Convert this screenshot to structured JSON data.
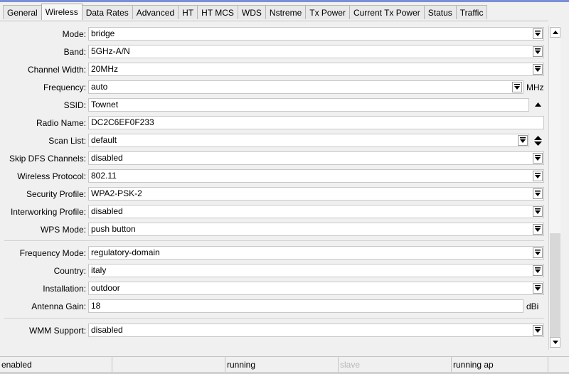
{
  "tabs": [
    "General",
    "Wireless",
    "Data Rates",
    "Advanced",
    "HT",
    "HT MCS",
    "WDS",
    "Nstreme",
    "Tx Power",
    "Current Tx Power",
    "Status",
    "Traffic"
  ],
  "active_tab": "Wireless",
  "fields": {
    "mode": {
      "label": "Mode:",
      "value": "bridge"
    },
    "band": {
      "label": "Band:",
      "value": "5GHz-A/N"
    },
    "channel_width": {
      "label": "Channel Width:",
      "value": "20MHz"
    },
    "frequency": {
      "label": "Frequency:",
      "value": "auto",
      "unit": "MHz"
    },
    "ssid": {
      "label": "SSID:",
      "value": "Townet"
    },
    "radio_name": {
      "label": "Radio Name:",
      "value": "DC2C6EF0F233"
    },
    "scan_list": {
      "label": "Scan List:",
      "value": "default"
    },
    "skip_dfs": {
      "label": "Skip DFS Channels:",
      "value": "disabled"
    },
    "wireless_protocol": {
      "label": "Wireless Protocol:",
      "value": "802.11"
    },
    "security_profile": {
      "label": "Security Profile:",
      "value": "WPA2-PSK-2"
    },
    "interworking_profile": {
      "label": "Interworking Profile:",
      "value": "disabled"
    },
    "wps_mode": {
      "label": "WPS Mode:",
      "value": "push button"
    },
    "frequency_mode": {
      "label": "Frequency Mode:",
      "value": "regulatory-domain"
    },
    "country": {
      "label": "Country:",
      "value": "italy"
    },
    "installation": {
      "label": "Installation:",
      "value": "outdoor"
    },
    "antenna_gain": {
      "label": "Antenna Gain:",
      "value": "18",
      "unit": "dBi"
    },
    "wmm_support": {
      "label": "WMM Support:",
      "value": "disabled"
    }
  },
  "status": [
    "enabled",
    "",
    "running",
    "slave",
    "running ap"
  ],
  "icons": {
    "dropdown": "dropdown-arrow-icon",
    "collapse": "collapse-up-icon",
    "updown": "up-down-arrows-icon",
    "scroll_up": "scroll-up-icon",
    "scroll_down": "scroll-down-icon"
  }
}
